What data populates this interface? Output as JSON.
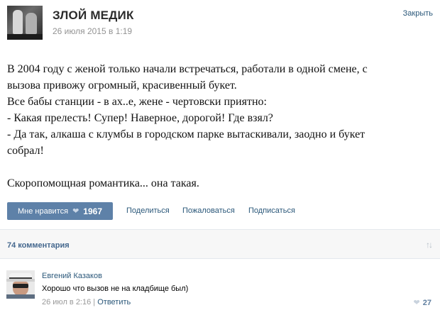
{
  "post": {
    "author": "ЗЛОЙ МЕДИК",
    "date": "26 июля 2015 в 1:19",
    "close_label": "Закрыть",
    "text_lines": [
      "В 2004 году с женой только начали встречаться, работали в одной смене, с",
      "вызова привожу огромный, красивенный букет.",
      "Все бабы станции - в ах..е, жене - чертовски приятно:",
      "- Какая прелесть! Супер! Наверное, дорогой! Где взял?",
      "- Да так, алкаша с клумбы в городском парке вытаскивали, заодно и букет",
      "собрал!",
      "Скоропомощная романтика... она такая."
    ]
  },
  "actions": {
    "like_label": "Мне нравится",
    "like_icon": "heart-icon",
    "like_count": "1967",
    "share_label": "Поделиться",
    "report_label": "Пожаловаться",
    "subscribe_label": "Подписаться"
  },
  "comments": {
    "count_label": "74 комментария",
    "sort_icon": "sort-arrows-icon",
    "items": [
      {
        "author": "Евгений Казаков",
        "text": "Хорошо что вызов не на кладбище был)",
        "date": "26 июл в 2:16",
        "separator": "|",
        "reply_label": "Ответить",
        "likes": "27"
      }
    ]
  },
  "colors": {
    "link": "#2b587a",
    "like_button": "#5e81a8",
    "muted": "#939393"
  }
}
